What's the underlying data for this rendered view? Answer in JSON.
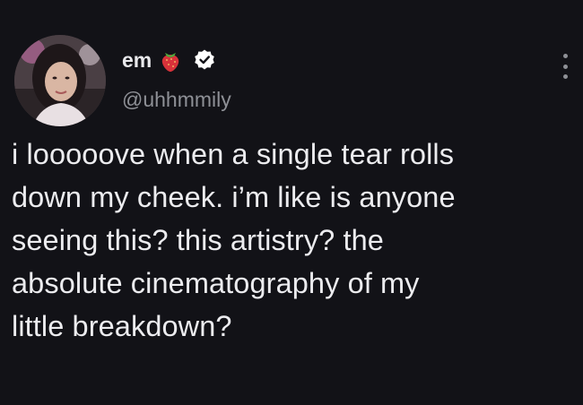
{
  "tweet": {
    "display_name": "em",
    "name_emoji": "strawberry-icon",
    "verified_icon": "verified-badge-icon",
    "handle": "@uhhmmily",
    "text_lines": [
      "i looooove when a single tear rolls",
      "down my cheek. i’m like is anyone",
      "seeing this? this artistry? the",
      "absolute cinematography of my",
      "little breakdown?"
    ]
  },
  "colors": {
    "background": "#121217",
    "text": "#ececef",
    "secondary_text": "#8e9096",
    "verified": "#ffffff",
    "strawberry": "#d8323a"
  }
}
